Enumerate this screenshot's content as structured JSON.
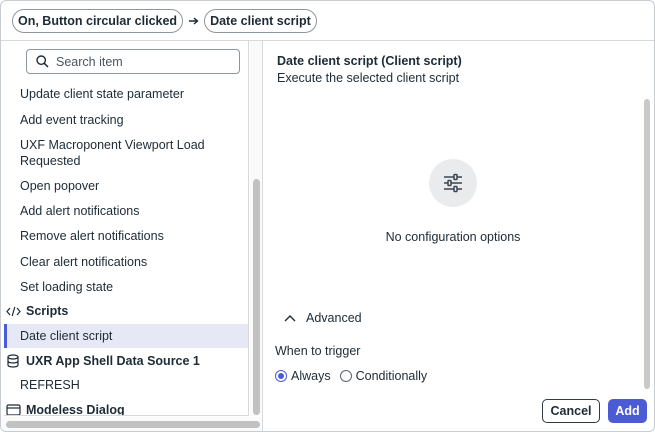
{
  "breadcrumb": {
    "items": [
      "On, Button circular clicked",
      "Date client script"
    ],
    "separator": "→"
  },
  "search": {
    "placeholder": "Search item",
    "value": ""
  },
  "list": {
    "items": [
      "Update client state parameter",
      "Add event tracking",
      "UXF Macroponent Viewport Load Requested",
      "Open popover",
      "Add alert notifications",
      "Remove alert notifications",
      "Clear alert notifications",
      "Set loading state"
    ],
    "groups": [
      {
        "label": "Scripts",
        "icon": "code-icon",
        "children": [
          "Date client script"
        ],
        "selected": "Date client script"
      },
      {
        "label": "UXR App Shell Data Source 1",
        "icon": "database-icon",
        "children": [
          "REFRESH"
        ]
      },
      {
        "label": "Modeless Dialog",
        "icon": "window-icon",
        "children": []
      }
    ]
  },
  "detail": {
    "title": "Date client script (Client script)",
    "subtitle": "Execute the selected client script",
    "empty_icon": "sliders-icon",
    "empty_text": "No configuration options",
    "advanced_label": "Advanced",
    "trigger_label": "When to trigger",
    "trigger_options": [
      "Always",
      "Conditionally"
    ],
    "trigger_selected": "Always"
  },
  "footer": {
    "cancel_label": "Cancel",
    "add_label": "Add"
  },
  "colors": {
    "accent": "#4b5bd6",
    "selected_bg": "#e6e9f5",
    "border": "#d6dadd",
    "text": "#1d2b36"
  }
}
